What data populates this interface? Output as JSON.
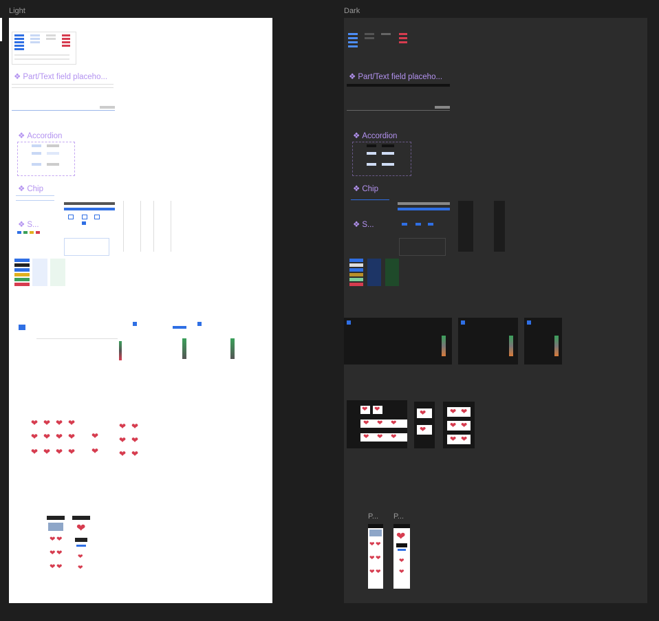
{
  "canvas": {
    "frames": [
      {
        "label": "Light",
        "components": [
          "Part/Text field placeho...",
          "Accordion",
          "Chip",
          "S..."
        ]
      },
      {
        "label": "Dark",
        "components": [
          "Part/Text field placeho...",
          "Accordion",
          "Chip",
          "S..."
        ],
        "page_labels": [
          "P...",
          "P..."
        ]
      }
    ]
  },
  "colors": {
    "canvas_bg": "#1e1e1e",
    "light_frame": "#ffffff",
    "dark_frame": "#2c2c2c",
    "component_title": "#b392f0",
    "accent_blue": "#2f6fe4",
    "accent_red": "#d63c4f"
  }
}
